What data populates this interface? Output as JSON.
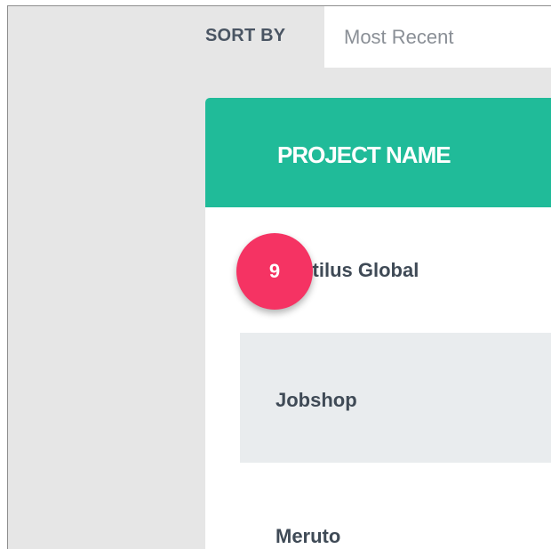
{
  "sort": {
    "label": "SORT BY",
    "selected": "Most Recent"
  },
  "table": {
    "header": {
      "project_name": "PROJECT NAME"
    },
    "rows": [
      {
        "project_name": "Nautilus Global"
      },
      {
        "project_name": "Jobshop"
      },
      {
        "project_name": "Meruto"
      }
    ]
  },
  "step_badge": {
    "number": "9"
  },
  "colors": {
    "header_bg": "#20bb99",
    "badge_bg": "#f53363",
    "alt_row_bg": "#e9ecee",
    "page_bg": "#e6e6e6"
  }
}
